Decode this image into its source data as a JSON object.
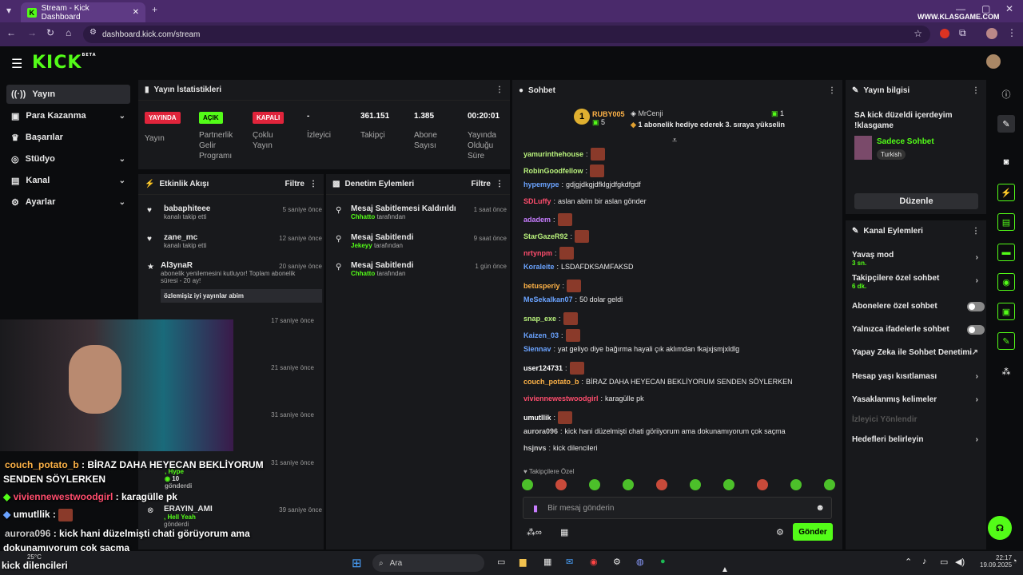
{
  "browser": {
    "tab_title": "Stream - Kick Dashboard",
    "url": "dashboard.kick.com/stream",
    "watermark": "WWW.KLASGAME.COM"
  },
  "header": {
    "logo": "KICK",
    "beta": "BETA"
  },
  "sidebar": [
    {
      "label": "Yayın"
    },
    {
      "label": "Para Kazanma"
    },
    {
      "label": "Başarılar"
    },
    {
      "label": "Stüdyo"
    },
    {
      "label": "Kanal"
    },
    {
      "label": "Ayarlar"
    }
  ],
  "stats": {
    "title": "Yayın İstatistikleri",
    "live": "YAYINDA",
    "live_lbl": "Yayın",
    "open": "AÇIK",
    "open_lbl": "Partnerlik Gelir Programı",
    "closed": "KAPALI",
    "closed_lbl": "Çoklu Yayın",
    "viewers": "-",
    "viewers_lbl": "İzleyici",
    "followers": "361.151",
    "followers_lbl": "Takipçi",
    "subs": "1.385",
    "subs_lbl": "Abone Sayısı",
    "uptime": "00:20:01",
    "uptime_lbl": "Yayında Olduğu Süre"
  },
  "activity": {
    "title": "Etkinlik Akışı",
    "filter": "Filtre",
    "items": [
      {
        "name": "babaphiteee",
        "sub": "kanalı takip etti",
        "time": "5 saniye önce"
      },
      {
        "name": "zane_mc",
        "sub": "kanalı takip etti",
        "time": "12 saniye önce"
      },
      {
        "name": "Al3ynaR",
        "sub": "abonelik yenilemesini kutluyor! Toplam abonelik süresi - 20 ay!",
        "time": "20 saniye önce",
        "msg": "özlemişiz iyi yayınlar abim"
      }
    ],
    "times": [
      "17 saniye önce",
      "21 saniye önce",
      "31 saniye önce",
      "31 saniye önce",
      "39 saniye önce"
    ],
    "hype": ", Hype",
    "hype_count": "10",
    "hype_sent": "gönderdi",
    "erayn": "ERAYIN_AMI",
    "hellyeah": ", Hell Yeah",
    "sent2": "gönderdi"
  },
  "moderation": {
    "title": "Denetim Eylemleri",
    "filter": "Filtre",
    "items": [
      {
        "action": "Mesaj Sabitlemesi Kaldırıldı",
        "by": "Chhatto",
        "by_suffix": "tarafından",
        "time": "1 saat önce"
      },
      {
        "action": "Mesaj Sabitlendi",
        "by": "Jekeyy",
        "by_suffix": "tarafından",
        "time": "9 saat önce"
      },
      {
        "action": "Mesaj Sabitlendi",
        "by": "Chhatto",
        "by_suffix": "tarafından",
        "time": "1 gün önce"
      }
    ]
  },
  "chat": {
    "title": "Sohbet",
    "top_user": "RUBY005",
    "top_count": "5",
    "rank": "1",
    "gifter": "MrCenji",
    "gifter_count": "1",
    "gift_text": "1 abonelik hediye ederek 3. sıraya yükselin",
    "messages": [
      {
        "u": "yamurinthehouse",
        "c": "#b9f27c",
        "t": ""
      },
      {
        "u": "RobinGoodfellow",
        "c": "#b9f27c",
        "t": ""
      },
      {
        "u": "hypemype",
        "c": "#6aa3ff",
        "t": "gdjgjdkgjdfklgjdfgkdfgdf"
      },
      {
        "u": "SDLuffy",
        "c": "#ff4d6d",
        "t": "aslan abim bir aslan gönder"
      },
      {
        "u": "adadem",
        "c": "#c77dff",
        "t": ""
      },
      {
        "u": "StarGazeR92",
        "c": "#b9f27c",
        "t": ""
      },
      {
        "u": "nrtynpm",
        "c": "#ff4d6d",
        "t": ""
      },
      {
        "u": "Koraleite",
        "c": "#6aa3ff",
        "t": "LSDAFDKSAMFAKSD"
      },
      {
        "u": "betusperiy",
        "c": "#ffb347",
        "t": ""
      },
      {
        "u": "MeSekalkan07",
        "c": "#6aa3ff",
        "t": "50 dolar geldi"
      },
      {
        "u": "snap_exe",
        "c": "#b9f27c",
        "t": ""
      },
      {
        "u": "Kaizen_03",
        "c": "#6aa3ff",
        "t": ""
      },
      {
        "u": "Siennav",
        "c": "#6aa3ff",
        "t": "yat geliyo diye bağırma hayali çık aklımdan fkajxjsmjxldlg"
      },
      {
        "u": "user124731",
        "c": "#ffffff",
        "t": ""
      },
      {
        "u": "couch_potato_b",
        "c": "#ffb347",
        "t": "BİRAZ DAHA HEYECAN BEKLİYORUM SENDEN SÖYLERKEN"
      },
      {
        "u": "viviennewestwoodgirl",
        "c": "#ff4d6d",
        "t": "karagülle pk"
      },
      {
        "u": "umutllik",
        "c": "#ffffff",
        "t": ""
      },
      {
        "u": "aurora096",
        "c": "#cccccc",
        "t": "kick hani düzelmişti chati göriiyorum ama dokunamıyorum çok saçma"
      },
      {
        "u": "hsjnvs",
        "c": "#cccccc",
        "t": "kick dilencileri"
      }
    ],
    "followers_only": "Takipçilere Özel",
    "placeholder": "Bir mesaj gönderin",
    "send": "Gönder"
  },
  "info": {
    "title": "Yayın bilgisi",
    "stream_title": "SA kick düzeldi içerdeyim !klasgame",
    "category": "Sadece Sohbet",
    "lang": "Turkish",
    "edit": "Düzenle"
  },
  "channel_actions": {
    "title": "Kanal Eylemleri",
    "slow": "Yavaş mod",
    "slow_val": "3 sn.",
    "follower_chat": "Takipçilere özel sohbet",
    "follower_val": "6 dk.",
    "sub_chat": "Abonelere özel sohbet",
    "emote_chat": "Yalnızca ifadelerle sohbet",
    "ai": "Yapay Zeka ile Sohbet Denetimi",
    "age": "Hesap yaşı kısıtlaması",
    "banned": "Yasaklanmış kelimeler",
    "redirect": "İzleyici Yönlendir",
    "goals": "Hedefleri belirleyin"
  },
  "overlay": {
    "l1u": "couch_potato_b",
    "l1t": "BİRAZ DAHA HEYECAN BEKLİYORUM",
    "l1t2": "SENDEN SÖYLERKEN",
    "l2u": "viviennewestwoodgirl",
    "l2t": "karagülle pk",
    "l3u": "umutllik",
    "l4u": "aurora096",
    "l4t": "kick hani düzelmişti chati görüyorum ama",
    "l4t2": "dokunamıyorum çok saçma",
    "l5": "kick dilencileri",
    "temp": "25°C"
  },
  "taskbar": {
    "search": "Ara",
    "time": "22:17",
    "date": "19.09.2025"
  },
  "colors": {
    "kick_green": "#53fc18",
    "browser_purple": "#4a2a6b"
  }
}
